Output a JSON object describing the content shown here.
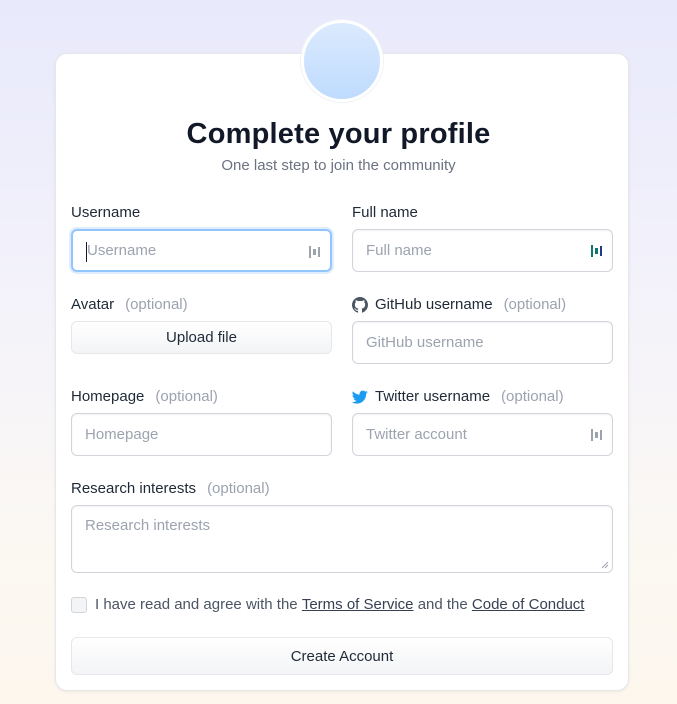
{
  "header": {
    "title": "Complete your profile",
    "subtitle": "One last step to join the community"
  },
  "fields": {
    "username": {
      "label": "Username",
      "placeholder": "Username",
      "value": ""
    },
    "fullname": {
      "label": "Full name",
      "placeholder": "Full name",
      "value": ""
    },
    "avatar": {
      "label": "Avatar",
      "optional": "(optional)",
      "button": "Upload file"
    },
    "github": {
      "label": "GitHub username",
      "optional": "(optional)",
      "placeholder": "GitHub username",
      "icon": "github-icon"
    },
    "homepage": {
      "label": "Homepage",
      "optional": "(optional)",
      "placeholder": "Homepage"
    },
    "twitter": {
      "label": "Twitter username",
      "optional": "(optional)",
      "placeholder": "Twitter account",
      "icon": "twitter-icon"
    },
    "interests": {
      "label": "Research interests",
      "optional": "(optional)",
      "placeholder": "Research interests"
    }
  },
  "terms": {
    "prefix": "I have read and agree with the",
    "tos": "Terms of Service",
    "middle": "and the",
    "coc": "Code of Conduct",
    "checked": false
  },
  "submit": {
    "label": "Create Account"
  },
  "colors": {
    "focus_ring": "#93c5fd",
    "twitter_blue": "#1d9bf0",
    "avatar_gradient_top": "#dbeafe",
    "avatar_gradient_bottom": "#bfdbfe",
    "placeholder": "#9ca3af"
  }
}
